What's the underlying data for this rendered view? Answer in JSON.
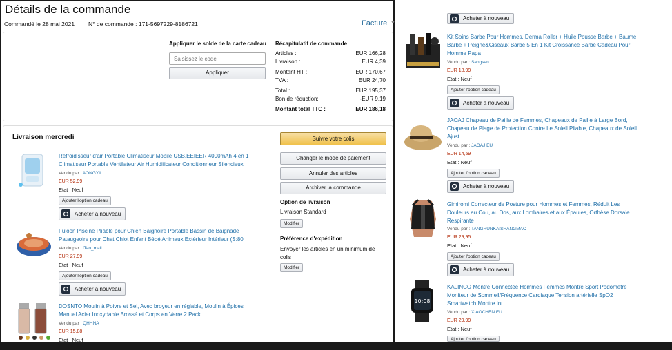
{
  "page": {
    "title": "Détails de la commande",
    "ordered_on": "Commandé le 28 mai 2021",
    "order_number": "N° de commande : 171-5697229-8186721",
    "invoice_link": "Facture"
  },
  "gift_card": {
    "heading": "Appliquer le solde de la carte cadeau",
    "placeholder": "Saisissez le code",
    "apply_label": "Appliquer"
  },
  "summary": {
    "heading": "Récapitulatif de commande",
    "rows": [
      {
        "label": "Articles :",
        "value": "EUR 166,28"
      },
      {
        "label": "Livraison :",
        "value": "EUR 4,39"
      },
      {
        "label": "Montant HT :",
        "value": "EUR 170,67"
      },
      {
        "label": "TVA :",
        "value": "EUR 24,70"
      },
      {
        "label": "Total :",
        "value": "EUR 195,37"
      },
      {
        "label": "Bon de réduction:",
        "value": "-EUR 9,19"
      },
      {
        "label": "Montant total TTC :",
        "value": "EUR 186,18"
      }
    ]
  },
  "delivery": {
    "heading": "Livraison mercredi",
    "track_label": "Suivre votre colis",
    "change_payment_label": "Changer le mode de paiement",
    "cancel_label": "Annuler des articles",
    "archive_label": "Archiver la commande",
    "option_heading": "Option de livraison",
    "option_value": "Livraison Standard",
    "modify_label": "Modifier",
    "pref_heading": "Préférence d'expédition",
    "pref_value_line1": "Envoyer les articles en un minimum de",
    "pref_value_line2": "colis",
    "modify_label2": "Modifier"
  },
  "labels": {
    "sold_by": "Vendu par :",
    "gift_option": "Ajouter l'option cadeau",
    "buy_again": "Acheter à nouveau"
  },
  "left_items": [
    {
      "title1": "Refroidisseur d'air Portable Climatiseur Mobile USB,EEIEER 4000mAh 4 en 1",
      "title2": "Climatiseur Portable Ventilateur Air Humidificateur Conditionneur Silencieux",
      "seller": "AONGYII",
      "price": "EUR 52,99",
      "condition": "Etat : Neuf"
    },
    {
      "title1": "Fuloon Piscine Pliable pour Chien Baignoire Portable Bassin de Baignade",
      "title2": "Pataugeoire pour Chat Chiot Enfant Bébé Animaux Extérieur Intérieur (S:80",
      "seller": "iTao_mall",
      "price": "EUR 27,99",
      "condition": "Etat : Neuf"
    },
    {
      "title1": "DOSNTO Moulin à Poivre et Sel, Avec broyeur en réglable, Moulin à Épices",
      "title2": "Manuel Acier Inoxydable Brossé et Corps en Verre 2 Pack",
      "seller": "QHHNA",
      "price": "EUR 15,88",
      "condition": "Etat : Neuf"
    }
  ],
  "right_items": [
    {
      "title1": "Kit Soins Barbe Pour Hommes, Derma Roller + Huile Pousse Barbe + Baume",
      "title2": "Barbe + Peigne&Ciseaux Barbe 5 En 1 Kit Croissance Barbe Cadeau Pour",
      "title3": "Homme Papa",
      "seller": "Sangsan",
      "price": "EUR 18,99",
      "condition": "Etat : Neuf"
    },
    {
      "title1": "JAOAJ Chapeau de Paille de Femmes, Chapeaux de Paille à Large Bord,",
      "title2": "Chapeau de Plage de Protection Contre Le Soleil Pliable, Chapeaux de Soleil",
      "title3": "Ajust",
      "seller": "JAOAJ EU",
      "price": "EUR 14,59",
      "condition": "Etat : Neuf"
    },
    {
      "title1": "Gimiromi Correcteur de Posture pour Hommes et Femmes, Réduit Les",
      "title2": "Douleurs au Cou, au Dos, aux Lombaires et aux Épaules, Orthèse Dorsale",
      "title3": "Respirante",
      "seller": "TANGRUNKAISHANGMAO",
      "price": "EUR 29,95",
      "condition": "Etat : Neuf"
    },
    {
      "title1": "KALINCO Montre Connectée Hommes Femmes Montre Sport Podometre",
      "title2": "Moniteur de Sommeil/Fréquence Cardiaque Tension artérielle SpO2",
      "title3": "Smartwatch Montre Int",
      "seller": "XIAOCHEN EU",
      "price": "EUR 29,99",
      "condition": "Etat : Neuf"
    }
  ]
}
